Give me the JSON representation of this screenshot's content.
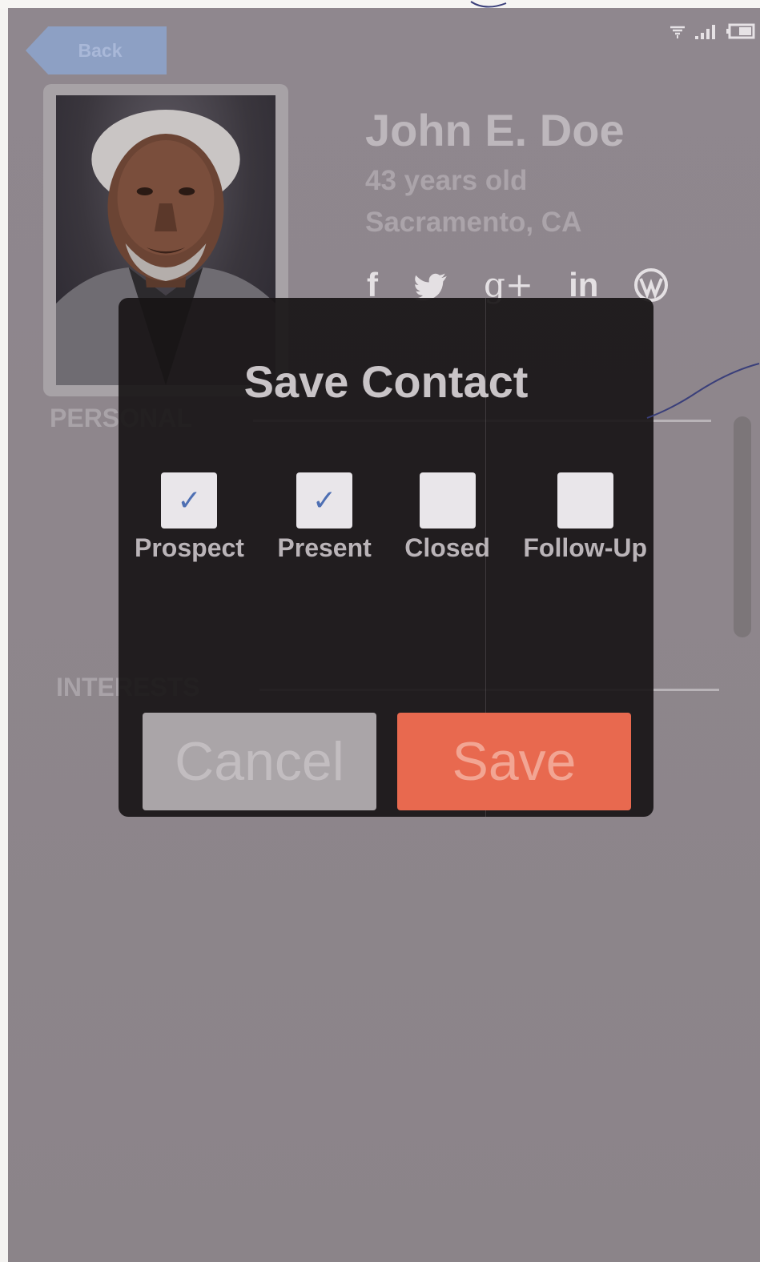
{
  "colors": {
    "screen_bg": "#8e868c",
    "dialog_bg": "#181516",
    "accent_save": "#e8694f",
    "cancel_bg": "#aaa5a8",
    "check_mark": "#4e6fb3",
    "back_button": "#8da0c4"
  },
  "status_bar": {
    "icons": [
      "wifi-icon",
      "signal-icon",
      "battery-icon"
    ]
  },
  "nav": {
    "back_label": "Back"
  },
  "profile": {
    "name": "John E. Doe",
    "age": "43 years old",
    "location": "Sacramento, CA",
    "social": [
      {
        "icon": "facebook-icon",
        "glyph": "f"
      },
      {
        "icon": "twitter-icon",
        "glyph": "🐦"
      },
      {
        "icon": "google-plus-icon",
        "glyph": "g+"
      },
      {
        "icon": "linkedin-icon",
        "glyph": "in"
      },
      {
        "icon": "wordpress-icon",
        "glyph": "W"
      }
    ]
  },
  "sections": {
    "personal": "PERSONAL",
    "interests": "INTERESTS"
  },
  "dialog": {
    "title": "Save Contact",
    "options": [
      {
        "label": "Prospect",
        "checked": true,
        "mark": "✓"
      },
      {
        "label": "Present",
        "checked": true,
        "mark": "✓"
      },
      {
        "label": "Closed",
        "checked": false,
        "mark": ""
      },
      {
        "label": "Follow-Up",
        "checked": false,
        "mark": ""
      }
    ],
    "cancel_label": "Cancel",
    "save_label": "Save"
  }
}
